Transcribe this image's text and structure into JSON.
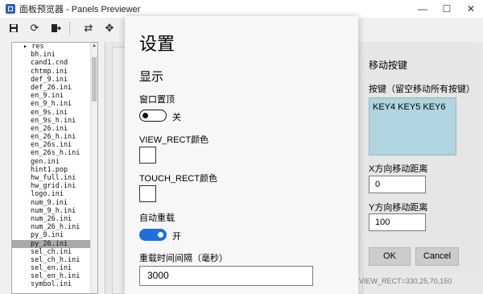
{
  "window": {
    "title": "面板预览器 - Panels Previewer",
    "controls": [
      "minimize-icon",
      "maximize-icon",
      "close-icon"
    ]
  },
  "toolbar": {
    "icons": [
      "save-icon",
      "refresh-icon",
      "export-icon",
      "swap-icon",
      "move-icon"
    ]
  },
  "file_list": {
    "items": [
      {
        "name": "res",
        "type": "folder"
      },
      {
        "name": "bh.ini"
      },
      {
        "name": "cand1.cnd"
      },
      {
        "name": "chtmp.ini"
      },
      {
        "name": "def_9.ini"
      },
      {
        "name": "def_26.ini"
      },
      {
        "name": "en_9.ini"
      },
      {
        "name": "en_9_h.ini"
      },
      {
        "name": "en_9s.ini"
      },
      {
        "name": "en_9s_h.ini"
      },
      {
        "name": "en_26.ini"
      },
      {
        "name": "en_26_h.ini"
      },
      {
        "name": "en_26s.ini"
      },
      {
        "name": "en_26s_h.ini"
      },
      {
        "name": "gen.ini"
      },
      {
        "name": "hint1.pop"
      },
      {
        "name": "hw_full.ini"
      },
      {
        "name": "hw_grid.ini"
      },
      {
        "name": "logo.ini"
      },
      {
        "name": "num_9.ini"
      },
      {
        "name": "num_9_h.ini"
      },
      {
        "name": "num_26.ini"
      },
      {
        "name": "num_26_h.ini"
      },
      {
        "name": "py_9.ini"
      },
      {
        "name": "py_26.ini",
        "selected": true
      },
      {
        "name": "sel_ch.ini"
      },
      {
        "name": "sel_ch_h.ini"
      },
      {
        "name": "sel_en.ini"
      },
      {
        "name": "sel_en_h.ini"
      },
      {
        "name": "symbol.ini"
      }
    ]
  },
  "settings": {
    "title": "设置",
    "section_display": "显示",
    "window_on_top": {
      "label": "窗口置顶",
      "state_text": "关",
      "on": false
    },
    "view_rect_color_label": "VIEW_RECT颜色",
    "touch_rect_color_label": "TOUCH_RECT颜色",
    "auto_reload": {
      "label": "自动重载",
      "state_text": "开",
      "on": true
    },
    "reload_interval": {
      "label": "重载时间间隔（毫秒）",
      "value": "3000"
    }
  },
  "key_move": {
    "title": "移动按键",
    "keys_label": "按键（留空移动所有按键）",
    "keys_value": "KEY4 KEY5 KEY6",
    "x_label": "X方向移动距离",
    "x_value": "0",
    "y_label": "Y方向移动距离",
    "y_value": "100",
    "ok_label": "OK",
    "cancel_label": "Cancel"
  },
  "status_line": "VIEW_RECT=330,25,70,150",
  "colors": {
    "toggle_on": "#1e6fd9",
    "keys_box": "#b0d4e0",
    "selected_row": "#a9a9a9"
  }
}
